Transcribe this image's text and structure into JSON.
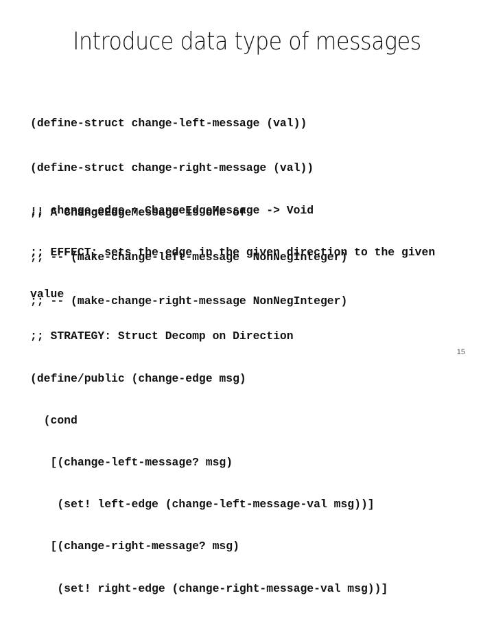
{
  "slide": {
    "title": "Introduce data type of messages",
    "page_number": "15",
    "code_block_1": [
      "(define-struct change-left-message (val))",
      "(define-struct change-right-message (val))",
      ";; A ChangeEdgeMessage is one of",
      ";; -- (make-change-left-message  NonNegInteger)",
      ";; -- (make-change-right-message NonNegInteger)"
    ],
    "code_block_2": [
      ";; change-edge : ChangeEdgeMessage -> Void",
      ";; EFFECT: sets the edge in the given direction to the given",
      "value",
      ";; STRATEGY: Struct Decomp on Direction",
      "(define/public (change-edge msg)",
      "  (cond",
      "   [(change-left-message? msg)",
      "    (set! left-edge (change-left-message-val msg))]",
      "   [(change-right-message? msg)",
      "    (set! right-edge (change-right-message-val msg))]"
    ]
  }
}
